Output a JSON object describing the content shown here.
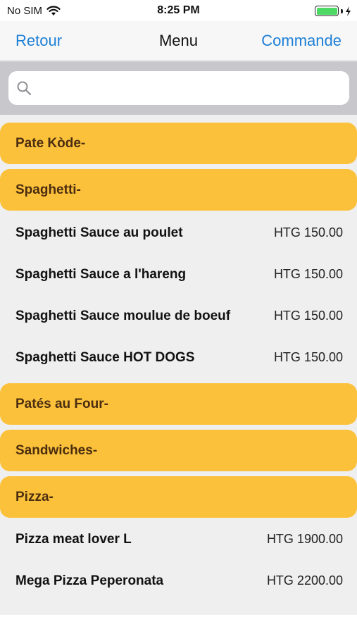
{
  "status_bar": {
    "carrier": "No SIM",
    "time": "8:25 PM",
    "battery_level": 1.0
  },
  "nav": {
    "back_label": "Retour",
    "title": "Menu",
    "action_label": "Commande"
  },
  "search": {
    "placeholder": "",
    "value": ""
  },
  "menu": [
    {
      "type": "category",
      "label": "Pate Kòde-"
    },
    {
      "type": "category",
      "label": "Spaghetti-"
    },
    {
      "type": "item",
      "name": "Spaghetti Sauce au poulet",
      "price": "HTG 150.00"
    },
    {
      "type": "item",
      "name": "Spaghetti Sauce a l'hareng",
      "price": "HTG 150.00"
    },
    {
      "type": "item",
      "name": "Spaghetti Sauce moulue de boeuf",
      "price": "HTG 150.00"
    },
    {
      "type": "item",
      "name": "Spaghetti Sauce HOT DOGS",
      "price": "HTG 150.00"
    },
    {
      "type": "category",
      "label": "Patés au Four-"
    },
    {
      "type": "category",
      "label": "Sandwiches-"
    },
    {
      "type": "category",
      "label": "Pizza-"
    },
    {
      "type": "item",
      "name": "Pizza meat lover L",
      "price": "HTG 1900.00"
    },
    {
      "type": "item",
      "name": "Mega Pizza Peperonata",
      "price": "HTG 2200.00"
    }
  ],
  "colors": {
    "accent": "#1d7fd6",
    "category_bg": "#fbc13b",
    "category_text": "#4b2d10",
    "list_bg": "#efefef"
  },
  "icons": {
    "wifi": "wifi-icon",
    "battery": "battery-icon",
    "charging": "charging-bolt-icon",
    "search": "search-icon"
  }
}
